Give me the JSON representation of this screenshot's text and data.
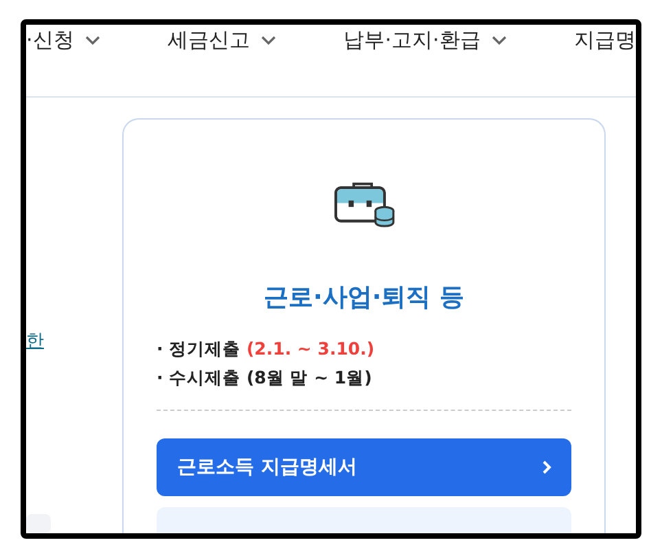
{
  "menu": [
    {
      "label": "·신청",
      "caret": true
    },
    {
      "label": "세금신고",
      "caret": true
    },
    {
      "label": "납부·고지·환급",
      "caret": true
    },
    {
      "label": "지급명",
      "caret": false
    }
  ],
  "side_link": "한",
  "card": {
    "title": "근로·사업·퇴직 등",
    "periods": [
      {
        "label": "· 정기제출",
        "range": "(2.1. ~ 3.10.)",
        "highlight": true
      },
      {
        "label": "· 수시제출",
        "range": "(8월 말 ~ 1월)",
        "highlight": false
      }
    ],
    "button": "근로소득 지급명세서"
  }
}
